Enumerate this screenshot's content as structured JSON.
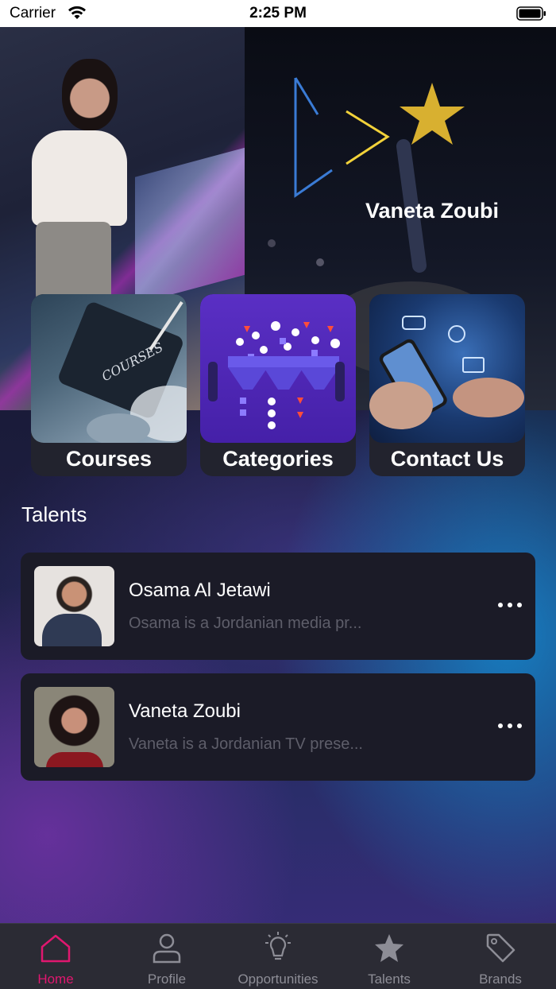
{
  "status_bar": {
    "carrier": "Carrier",
    "time": "2:25 PM"
  },
  "hero": {
    "featured_name": "Vaneta Zoubi"
  },
  "categories": [
    {
      "label": "Courses",
      "image_text": "COURSES"
    },
    {
      "label": "Categories"
    },
    {
      "label": "Contact Us"
    }
  ],
  "talents_section": {
    "title": "Talents",
    "items": [
      {
        "name": "Osama Al Jetawi",
        "description": "Osama is a Jordanian media pr..."
      },
      {
        "name": "Vaneta Zoubi",
        "description": "Vaneta is a Jordanian TV prese..."
      }
    ]
  },
  "tabbar": {
    "items": [
      {
        "label": "Home",
        "icon": "home-icon",
        "active": true
      },
      {
        "label": "Profile",
        "icon": "profile-icon",
        "active": false
      },
      {
        "label": "Opportunities",
        "icon": "lightbulb-icon",
        "active": false
      },
      {
        "label": "Talents",
        "icon": "star-icon",
        "active": false
      },
      {
        "label": "Brands",
        "icon": "tag-icon",
        "active": false
      }
    ]
  },
  "colors": {
    "accent": "#e0176f",
    "inactive_tab": "#8d8d96",
    "card_bg": "#1b1b27"
  }
}
